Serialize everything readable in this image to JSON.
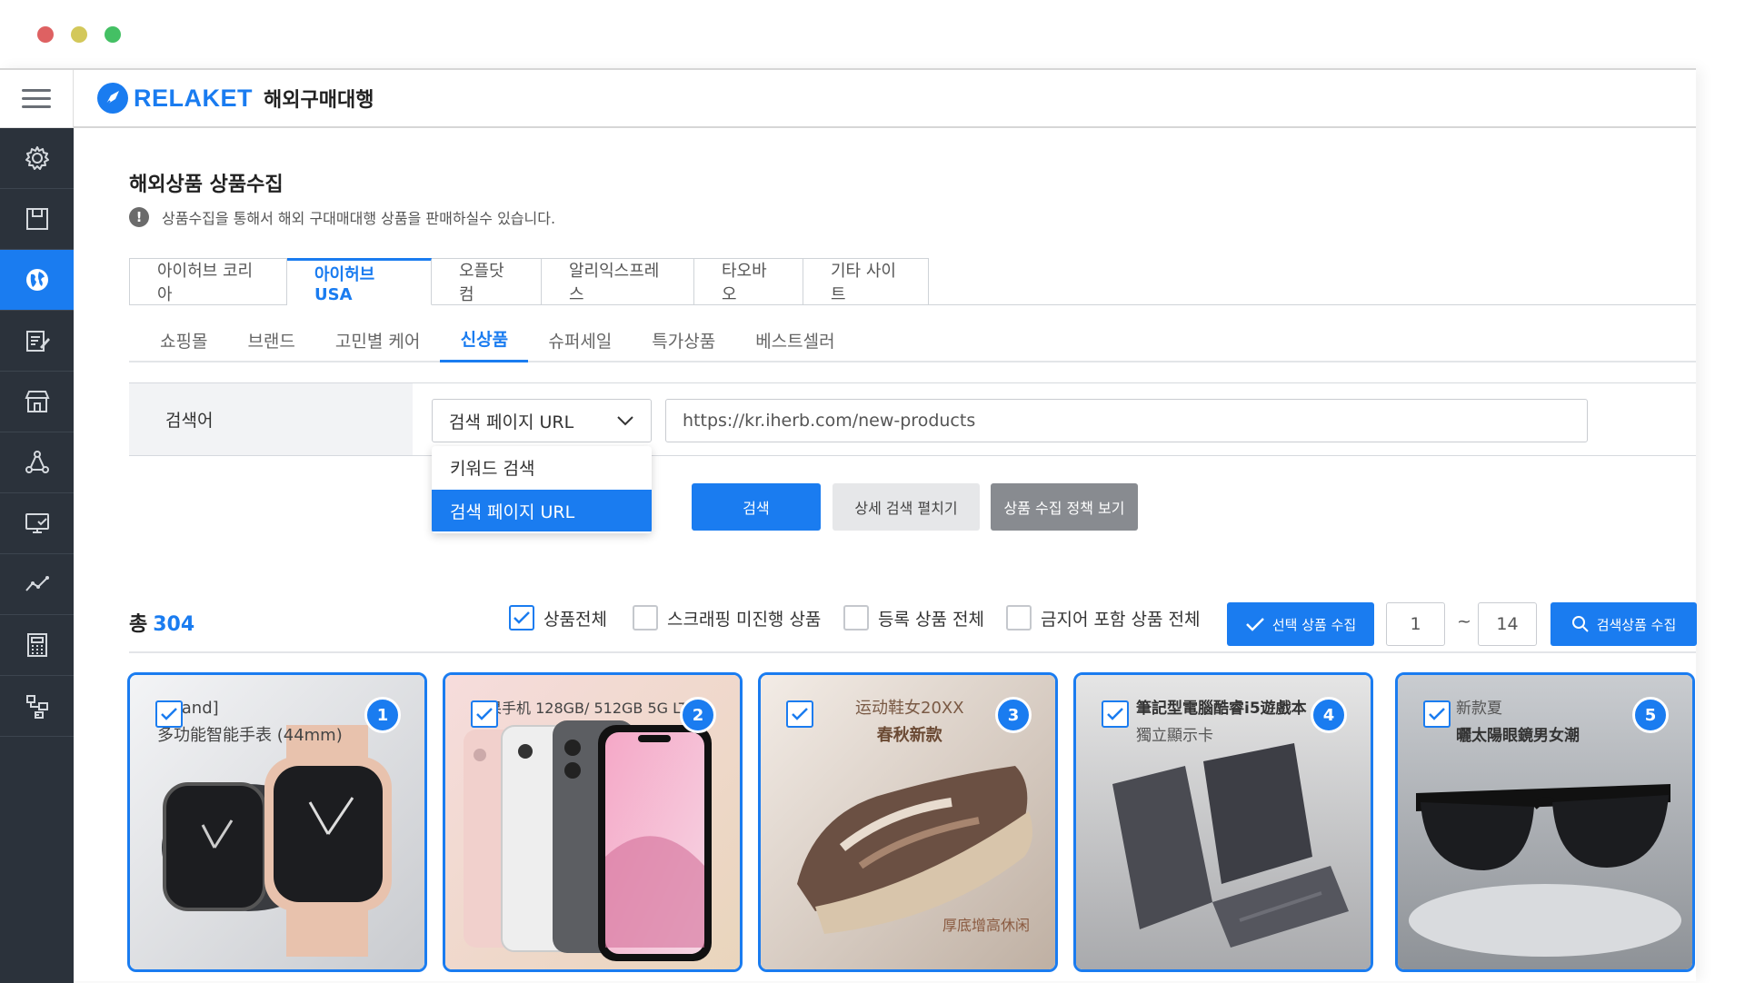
{
  "header": {
    "logo_text": "RELAKET",
    "logo_sub": "해외구매대행"
  },
  "page": {
    "title": "해외상품 상품수집",
    "description": "상품수집을 통해서 해외 구대매대행 상품을 판매하실수 있습니다."
  },
  "site_tabs": [
    {
      "label": "아이허브 코리아"
    },
    {
      "label": "아이허브 USA"
    },
    {
      "label": "오플닷컴"
    },
    {
      "label": "알리익스프레스"
    },
    {
      "label": "타오바오"
    },
    {
      "label": "기타 사이트"
    }
  ],
  "sub_tabs": [
    {
      "label": "쇼핑몰"
    },
    {
      "label": "브랜드"
    },
    {
      "label": "고민별 케어"
    },
    {
      "label": "신상품"
    },
    {
      "label": "슈퍼세일"
    },
    {
      "label": "특가상품"
    },
    {
      "label": "베스트셀러"
    }
  ],
  "search": {
    "label": "검색어",
    "select_value": "검색 페이지 URL",
    "options": [
      "키워드 검색",
      "검색 페이지 URL"
    ],
    "url_value": "https://kr.iherb.com/new-products"
  },
  "buttons": {
    "search": "검색",
    "detail": "상세 검색 펼치기",
    "policy": "상품 수집 정책 보기"
  },
  "results": {
    "total_label": "총",
    "total_count": "304",
    "filters": [
      {
        "label": "상품전체",
        "checked": true
      },
      {
        "label": "스크래핑 미진행 상품",
        "checked": false
      },
      {
        "label": "등록 상품 전체",
        "checked": false
      },
      {
        "label": "금지어 포함 상품 전체",
        "checked": false
      }
    ],
    "collect_selected": "선택 상품 수집",
    "page_from": "1",
    "tilde": "~",
    "page_to": "14",
    "search_collect": "검색상품 수집"
  },
  "products": [
    {
      "index": "1",
      "line1": "[Brand]",
      "line2": "多功能智能手表 (44mm)"
    },
    {
      "index": "2",
      "line1": "苹果手机 128GB/ 512GB 5G LTE",
      "line2": ""
    },
    {
      "index": "3",
      "line1": "运动鞋女20XX",
      "line2": "春秋新款",
      "line3": "厚底增高休闲"
    },
    {
      "index": "4",
      "line1": "筆記型電腦酷睿i5遊戲本",
      "line2": "獨立顯示卡"
    },
    {
      "index": "5",
      "line1": "新款夏",
      "line2": "曬太陽眼鏡男女潮"
    }
  ],
  "colors": {
    "accent": "#1a7cf0",
    "sidebar": "#2b323b"
  }
}
